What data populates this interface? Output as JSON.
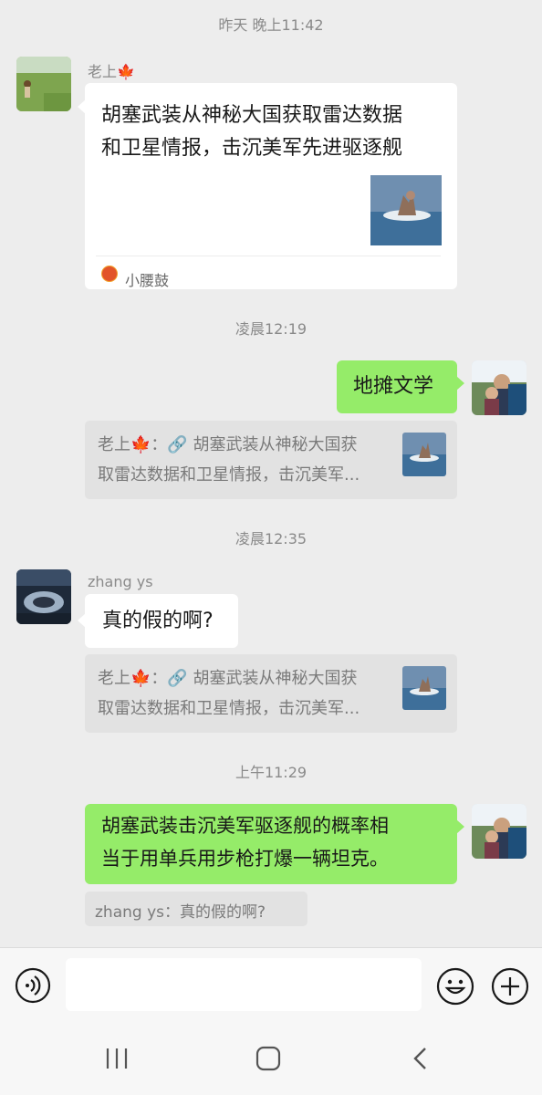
{
  "timestamps": [
    "昨天 晚上11:42",
    "凌晨12:19",
    "凌晨12:35",
    "上午11:29"
  ],
  "messages": {
    "m1": {
      "sender": "老上🍁",
      "article_title_line1": "胡塞武装从神秘大国获取雷达数据",
      "article_title_line2": "和卫星情报，击沉美军先进驱逐舰",
      "source_name": "小腰鼓",
      "source_icon_text": "小腰鼓"
    },
    "m2": {
      "text": "地摊文学",
      "quote_line1": "老上🍁：🔗 胡塞武装从神秘大国获",
      "quote_line2": "取雷达数据和卫星情报，击沉美军..."
    },
    "m3": {
      "sender": "zhang ys",
      "text": "真的假的啊?",
      "quote_line1": "老上🍁：🔗 胡塞武装从神秘大国获",
      "quote_line2": "取雷达数据和卫星情报，击沉美军..."
    },
    "m4": {
      "text_line1": "胡塞武装击沉美军驱逐舰的概率相",
      "text_line2": "当于用单兵用步枪打爆一辆坦克。",
      "quote": "zhang ys：真的假的啊?"
    }
  },
  "input": {
    "value": "",
    "placeholder": ""
  },
  "icons": {
    "voice": "voice-icon",
    "emoji": "emoji-icon",
    "plus": "plus-icon",
    "nav_recents": "recents-icon",
    "nav_home": "home-icon",
    "nav_back": "back-icon"
  },
  "colors": {
    "background": "#ededed",
    "bubble_green": "#95ec69",
    "bubble_white": "#ffffff",
    "quote_bg": "#e2e2e2"
  }
}
